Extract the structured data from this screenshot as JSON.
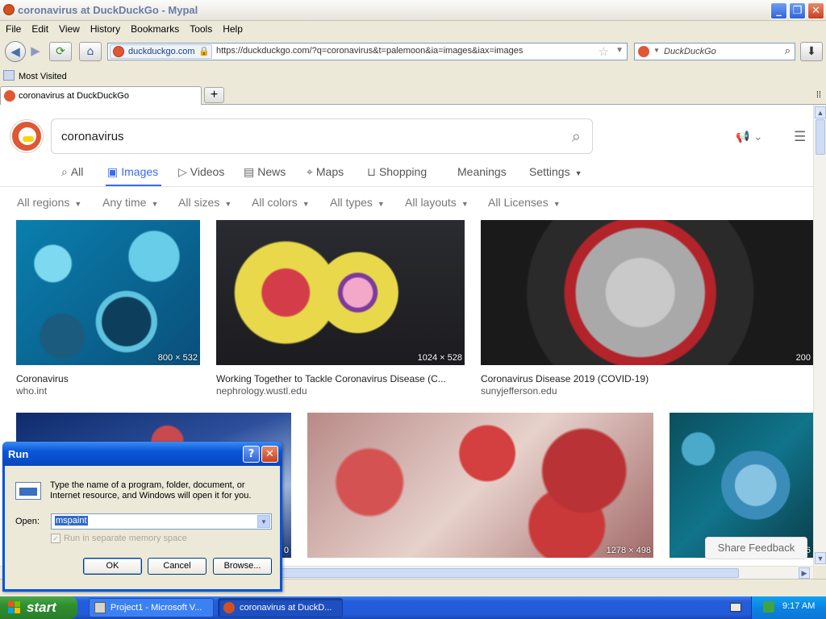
{
  "window": {
    "title": "coronavirus at DuckDuckGo - Mypal",
    "minimize": "_",
    "restore": "❐",
    "close": "✕"
  },
  "menu": [
    "File",
    "Edit",
    "View",
    "History",
    "Bookmarks",
    "Tools",
    "Help"
  ],
  "nav": {
    "site_label": "duckduckgo.com",
    "url": "https://duckduckgo.com/?q=coronavirus&t=palemoon&ia=images&iax=images",
    "search_placeholder": "DuckDuckGo"
  },
  "bookmarks": {
    "most_visited": "Most Visited"
  },
  "tabs": [
    {
      "title": "coronavirus at DuckDuckGo"
    }
  ],
  "page": {
    "query": "coronavirus",
    "nav_tabs": [
      {
        "label": "All",
        "icon": "search-icon"
      },
      {
        "label": "Images",
        "icon": "image-icon"
      },
      {
        "label": "Videos",
        "icon": "play-icon"
      },
      {
        "label": "News",
        "icon": "newspaper-icon"
      },
      {
        "label": "Maps",
        "icon": "map-pin-icon"
      },
      {
        "label": "Shopping",
        "icon": "bag-icon"
      },
      {
        "label": "Meanings",
        "icon": ""
      },
      {
        "label": "Settings",
        "icon": ""
      }
    ],
    "active_tab": "Images",
    "filters": [
      "All regions",
      "Any time",
      "All sizes",
      "All colors",
      "All types",
      "All layouts",
      "All Licenses"
    ],
    "results": [
      {
        "title": "Coronavirus",
        "source": "who.int",
        "dims": "800 × 532"
      },
      {
        "title": "Working Together to Tackle Coronavirus Disease (C...",
        "source": "nephrology.wustl.edu",
        "dims": "1024 × 528"
      },
      {
        "title": "Coronavirus Disease 2019 (COVID-19)",
        "source": "sunyjefferson.edu",
        "dims": "200"
      },
      {
        "title": "",
        "source": "",
        "dims": "0"
      },
      {
        "title": "",
        "source": "",
        "dims": "1278 × 498"
      },
      {
        "title": "",
        "source": "",
        "dims": "6"
      }
    ],
    "feedback": "Share Feedback"
  },
  "run_dialog": {
    "title": "Run",
    "description": "Type the name of a program, folder, document, or Internet resource, and Windows will open it for you.",
    "open_label": "Open:",
    "open_value": "mspaint",
    "checkbox_label": "Run in separate memory space",
    "ok": "OK",
    "cancel": "Cancel",
    "browse": "Browse..."
  },
  "taskbar": {
    "start": "start",
    "items": [
      "Project1 - Microsoft V...",
      "coronavirus at DuckD..."
    ],
    "clock": "9:17 AM"
  },
  "colors": {
    "accent": "#3969ef",
    "ddg_orange": "#de5833",
    "xp_blue": "#245edb",
    "start_green": "#2f8f2f"
  }
}
